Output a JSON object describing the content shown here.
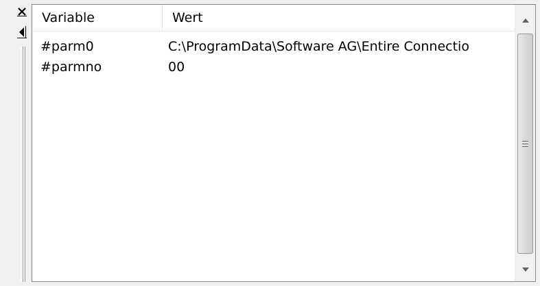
{
  "icons": {
    "close": "close-icon",
    "collapse": "collapse-left-icon",
    "scroll_up": "arrow-up-icon",
    "scroll_down": "arrow-down-icon",
    "thumb": "scroll-grip-icon"
  },
  "table": {
    "columns": [
      "Variable",
      "Wert"
    ],
    "rows": [
      {
        "variable": "#parm0",
        "value": "C:\\ProgramData\\Software AG\\Entire Connectio"
      },
      {
        "variable": "#parmno",
        "value": "00"
      }
    ]
  }
}
